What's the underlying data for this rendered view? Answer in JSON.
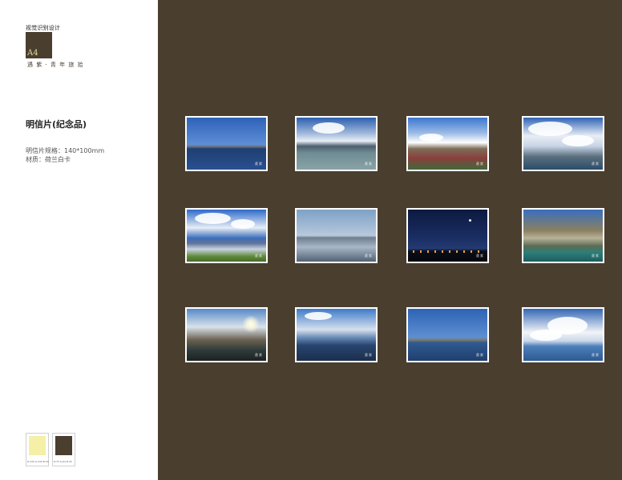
{
  "sidebar": {
    "section_title": "视觉识别设计",
    "page_label": "A4",
    "brand_tagline": "遇 紫 · 青 年 旅 拾",
    "heading": "明信片(纪念品)",
    "spec_size": "明信片规格：140*100mm",
    "spec_material": "材质：荷兰白卡"
  },
  "swatches": [
    {
      "color": "#f4f0a8",
      "code": "R:245 G:240 B:168"
    },
    {
      "color": "#4a3e2f",
      "code": "R:75 G:64 B:45"
    }
  ],
  "postcards": [
    {
      "scene": "lake-blue-sky-icon",
      "signature": "遇 紫"
    },
    {
      "scene": "clouds-mountain-lake-icon",
      "signature": "遇 紫"
    },
    {
      "scene": "snow-mountain-prayer-flags-icon",
      "signature": "遇 紫"
    },
    {
      "scene": "cloudy-sky-shore-icon",
      "signature": "遇 紫"
    },
    {
      "scene": "mountain-reflection-lake-icon",
      "signature": "遇 紫"
    },
    {
      "scene": "salt-flat-people-icon",
      "signature": "遇 紫"
    },
    {
      "scene": "night-moon-lights-icon",
      "signature": "遇 紫"
    },
    {
      "scene": "cliff-green-water-icon",
      "signature": "遇 紫"
    },
    {
      "scene": "sunset-hillside-icon",
      "signature": "遇 紫"
    },
    {
      "scene": "boat-on-lake-icon",
      "signature": "遇 紫"
    },
    {
      "scene": "calm-sea-horizon-icon",
      "signature": "遇 紫"
    },
    {
      "scene": "cumulus-clouds-lake-icon",
      "signature": "遇 紫"
    }
  ]
}
